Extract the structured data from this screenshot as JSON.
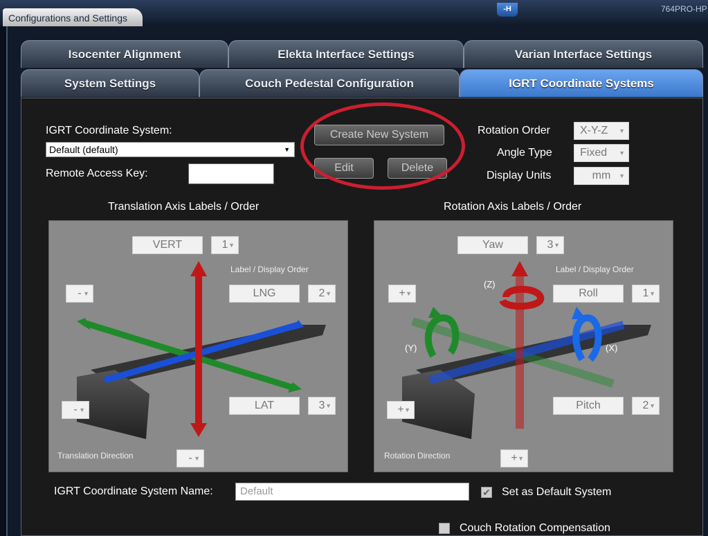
{
  "window": {
    "title": "Configurations and Settings",
    "host": "764PRO-HP",
    "icon_text": "-H"
  },
  "tabs": {
    "row1": [
      "Isocenter Alignment",
      "Elekta Interface Settings",
      "Varian Interface Settings"
    ],
    "row2": [
      "System Settings",
      "Couch Pedestal Configuration",
      "IGRT Coordinate Systems"
    ],
    "active": "IGRT Coordinate Systems"
  },
  "form": {
    "system_label": "IGRT Coordinate System:",
    "system_value": "Default (default)",
    "remote_key_label": "Remote Access Key:",
    "remote_key_value": "",
    "create_button": "Create New System",
    "edit_button": "Edit",
    "delete_button": "Delete",
    "rotation_order_label": "Rotation Order",
    "rotation_order_value": "X-Y-Z",
    "angle_type_label": "Angle Type",
    "angle_type_value": "Fixed",
    "display_units_label": "Display Units",
    "display_units_value": "mm"
  },
  "translation": {
    "title": "Translation Axis Labels / Order",
    "order_caption": "Label / Display Order",
    "direction_caption": "Translation Direction",
    "vert_label": "VERT",
    "vert_order": "1",
    "lng_label": "LNG",
    "lng_order": "2",
    "lat_label": "LAT",
    "lat_order": "3",
    "sign_upper_left": "-",
    "sign_lower_left": "-",
    "sign_bottom": "-"
  },
  "rotation": {
    "title": "Rotation Axis Labels / Order",
    "order_caption": "Label / Display Order",
    "direction_caption": "Rotation Direction",
    "yaw_label": "Yaw",
    "yaw_order": "3",
    "roll_label": "Roll",
    "roll_order": "1",
    "pitch_label": "Pitch",
    "pitch_order": "2",
    "axis_z": "(Z)",
    "axis_y": "(Y)",
    "axis_x": "(X)",
    "sign_upper_left": "+",
    "sign_lower_left": "+",
    "sign_bottom": "+"
  },
  "footer": {
    "name_label": "IGRT Coordinate System Name:",
    "name_value": "Default",
    "default_checkbox": "Set as Default System",
    "default_checked": true,
    "couch_checkbox": "Couch Rotation Compensation",
    "couch_checked": false
  },
  "colors": {
    "active_tab": "#4f8ee0",
    "highlight": "#cc1f2f",
    "vertical_axis": "#c01818",
    "green_axis": "#1f8a2a",
    "blue_axis": "#1a4fd8"
  }
}
